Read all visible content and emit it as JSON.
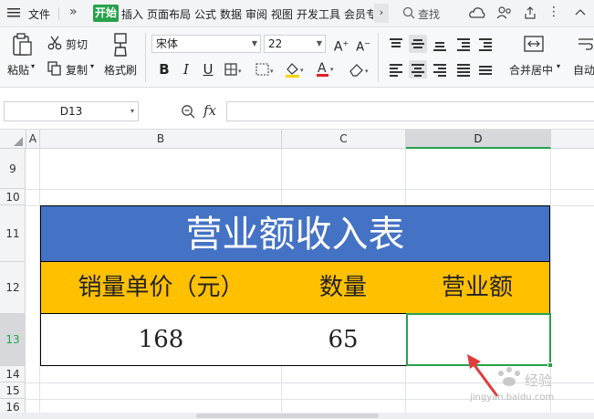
{
  "menubar": {
    "file": "文件",
    "tabs": [
      "开始",
      "插入",
      "页面布局",
      "公式",
      "数据",
      "审阅",
      "视图",
      "开发工具",
      "会员专"
    ],
    "search": "查找"
  },
  "ribbon": {
    "paste": "粘贴",
    "cut": "剪切",
    "copy": "复制",
    "format_painter": "格式刷",
    "font_name": "宋体",
    "font_size": "22",
    "merge_center": "合并居中",
    "auto_wrap": "自动"
  },
  "formula_bar": {
    "name_box": "D13",
    "fx": "fx"
  },
  "grid": {
    "columns": [
      "A",
      "B",
      "C",
      "D"
    ],
    "rows": [
      "9",
      "10",
      "11",
      "12",
      "13",
      "14",
      "15",
      "16"
    ],
    "selected_column": "D",
    "selected_row": "13"
  },
  "table": {
    "title": "营业额收入表",
    "headers": [
      "销量单价（元）",
      "数量",
      "营业额"
    ],
    "values": [
      "168",
      "65",
      ""
    ]
  },
  "colors": {
    "title_bg": "#4472c4",
    "header_bg": "#ffc000",
    "accent": "#27a14b",
    "annotation_arrow": "#e23b3b"
  },
  "watermark": "jingyan.baidu.com"
}
